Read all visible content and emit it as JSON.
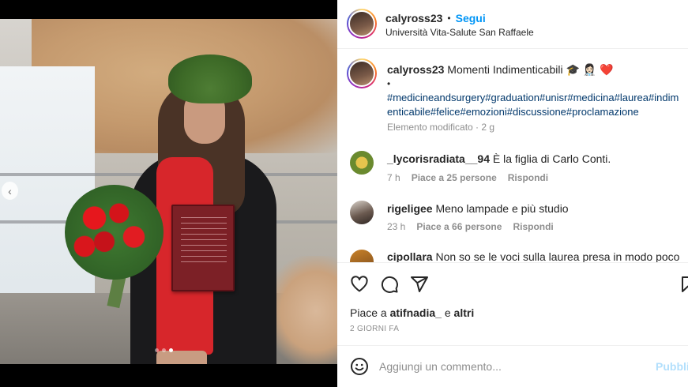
{
  "post": {
    "username": "calyross23",
    "follow_label": "Segui",
    "location": "Università Vita-Salute San Raffaele",
    "caption_title": "Momenti Indimenticabili",
    "caption_emojis": "🎓 👩🏻‍⚕️ ❤️",
    "caption_bullet": "•",
    "hashtags_line1": "#medicineandsurgery#graduation#unisr#medicina#laurea#indim",
    "hashtags_line2": "enticabile#felice#emozioni#discussione#proclamazione",
    "edited_label": "Elemento modificato · 2 g"
  },
  "comments": [
    {
      "username": "_lycorisradiata__94",
      "text": "È la figlia di Carlo Conti.",
      "time": "7 h",
      "likes": "Piace a 25 persone",
      "reply": "Rispondi"
    },
    {
      "username": "rigeligee",
      "text": "Meno lampade e più studio",
      "time": "23 h",
      "likes": "Piace a 66 persone",
      "reply": "Rispondi"
    },
    {
      "username": "cipollara",
      "text": "Non so se le voci sulla laurea presa in modo poco"
    }
  ],
  "actions": {
    "likes_prefix": "Piace a",
    "liked_by": "atifnadia_",
    "likes_connector": "e",
    "likes_others": "altri",
    "time_ago": "2 GIORNI FA"
  },
  "composer": {
    "placeholder": "Aggiungi un commento...",
    "publish_label": "Pubblica"
  },
  "icons": [
    "heart-icon",
    "comment-icon",
    "share-icon",
    "bookmark-icon",
    "emoji-icon",
    "chevron-left-icon"
  ],
  "colors": {
    "accent": "#0095f6",
    "hashtag": "#00376b",
    "muted": "#8e8e8e",
    "publish_disabled": "#b2dffc"
  }
}
